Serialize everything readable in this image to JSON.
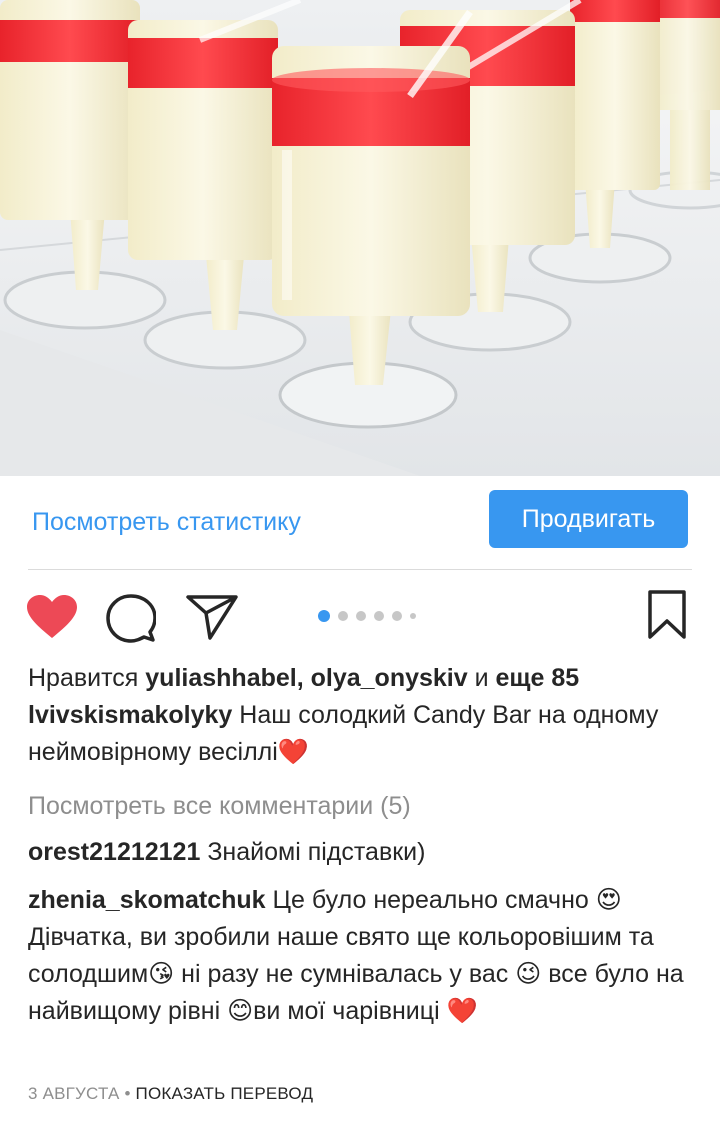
{
  "post": {
    "stats_link": "Посмотреть статистику",
    "promote_button": "Продвигать"
  },
  "actions": {
    "like_icon": "heart-filled-icon",
    "comment_icon": "comment-icon",
    "share_icon": "paper-plane-icon",
    "save_icon": "bookmark-icon",
    "carousel_dots": 6,
    "carousel_active": 1,
    "like_color": "#ed4956"
  },
  "likes": {
    "prefix": "Нравится",
    "users": "yuliashhabel, olya_onyskiv",
    "and": "и",
    "more": "еще 85"
  },
  "caption": {
    "username": "lvivskismakolyky",
    "text": "Наш солодкий Candy Bar на одному неймовірному весіллі❤️"
  },
  "view_all_comments": "Посмотреть все комментарии (5)",
  "comments": [
    {
      "username": "orest21212121",
      "text": "Знайомі підставки)"
    },
    {
      "username": "zhenia_skomatchuk",
      "text": "Це було нереально смачно 😍 Дівчатка, ви зробили наше свято ще кольоровішим та солодшим😘 ні разу не сумнівалась у вас 😉 все було на найвищому рівні 😊ви мої чарівниці ❤️"
    }
  ],
  "footer": {
    "date": "3 АВГУСТА",
    "separator": " • ",
    "translate": "ПОКАЗАТЬ ПЕРЕВОД"
  },
  "colors": {
    "accent": "#3897f0",
    "text": "#262626",
    "muted": "#8e8e8e",
    "jelly_red": "#f0333a",
    "cream": "#f8f4dc"
  }
}
